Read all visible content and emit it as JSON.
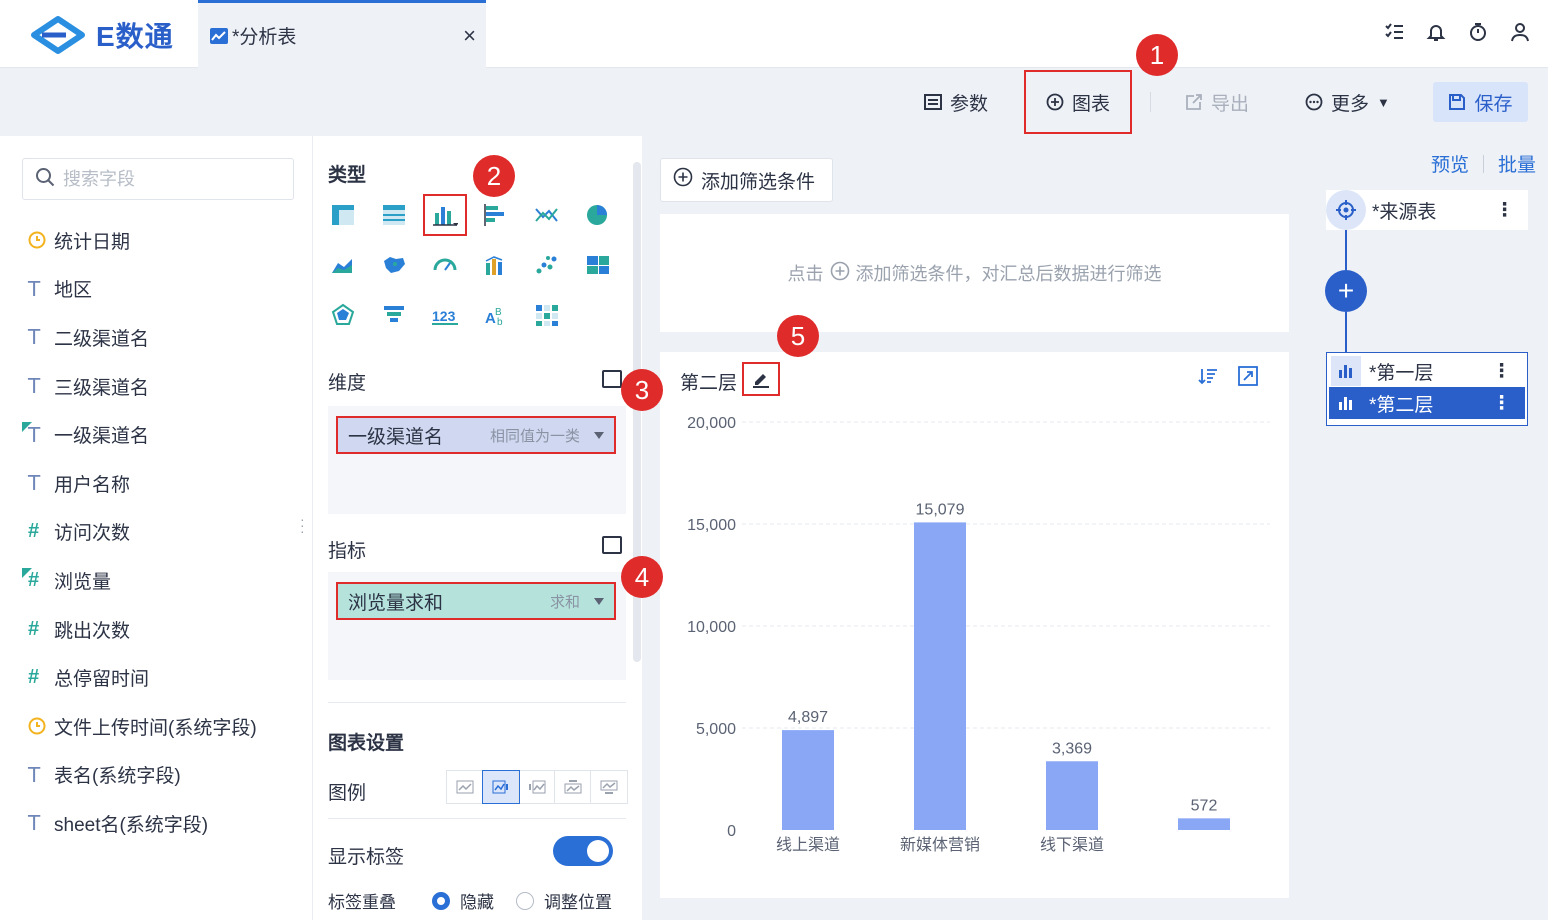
{
  "app": {
    "logo_text": "E数通"
  },
  "tab": {
    "label": "*分析表",
    "close": "×"
  },
  "toolbar": {
    "params": "参数",
    "chart": "图表",
    "export": "导出",
    "more": "更多",
    "save": "保存"
  },
  "fields": {
    "search_placeholder": "搜索字段",
    "items": [
      {
        "type": "date",
        "label": "统计日期"
      },
      {
        "type": "text",
        "label": "地区"
      },
      {
        "type": "text",
        "label": "二级渠道名"
      },
      {
        "type": "text",
        "label": "三级渠道名"
      },
      {
        "type": "text-calc",
        "label": "一级渠道名"
      },
      {
        "type": "text",
        "label": "用户名称"
      },
      {
        "type": "number",
        "label": "访问次数"
      },
      {
        "type": "number-calc",
        "label": "浏览量"
      },
      {
        "type": "number",
        "label": "跳出次数"
      },
      {
        "type": "number",
        "label": "总停留时间"
      },
      {
        "type": "date",
        "label": "文件上传时间(系统字段)"
      },
      {
        "type": "text",
        "label": "表名(系统字段)"
      },
      {
        "type": "text",
        "label": "sheet名(系统字段)"
      }
    ]
  },
  "config": {
    "type_title": "类型",
    "dimension_label": "维度",
    "dimension_pill": {
      "name": "一级渠道名",
      "sub": "相同值为一类"
    },
    "measure_label": "指标",
    "measure_pill": {
      "name": "浏览量求和",
      "sub": "求和"
    },
    "chart_settings_title": "图表设置",
    "legend_label": "图例",
    "show_labels_label": "显示标签",
    "show_labels_on": true,
    "overlap_label": "标签重叠",
    "overlap_options": [
      "隐藏",
      "调整位置"
    ],
    "overlap_selected": "隐藏"
  },
  "main": {
    "add_filter": "添加筛选条件",
    "filter_hint_prefix": "点击",
    "filter_hint_suffix": "添加筛选条件，对汇总后数据进行筛选",
    "chart_title": "第二层"
  },
  "chart_data": {
    "type": "bar",
    "categories": [
      "线上渠道",
      "新媒体营销",
      "线下渠道",
      ""
    ],
    "values": [
      4897,
      15079,
      3369,
      572
    ],
    "value_labels": [
      "4,897",
      "15,079",
      "3,369",
      "572"
    ],
    "yticks": [
      "0",
      "5,000",
      "10,000",
      "15,000",
      "20,000"
    ],
    "ylim": [
      0,
      20000
    ],
    "grid": true,
    "color": "#89a7f5"
  },
  "right": {
    "preview": "预览",
    "batch": "批量",
    "source_node": "*来源表",
    "layers": [
      "*第一层",
      "*第二层"
    ],
    "selected_layer": "*第二层"
  },
  "callouts": [
    "1",
    "2",
    "3",
    "4",
    "5"
  ],
  "colors": {
    "accent": "#2a5fc9",
    "highlight": "#e02b2b",
    "bar": "#89a7f5"
  }
}
